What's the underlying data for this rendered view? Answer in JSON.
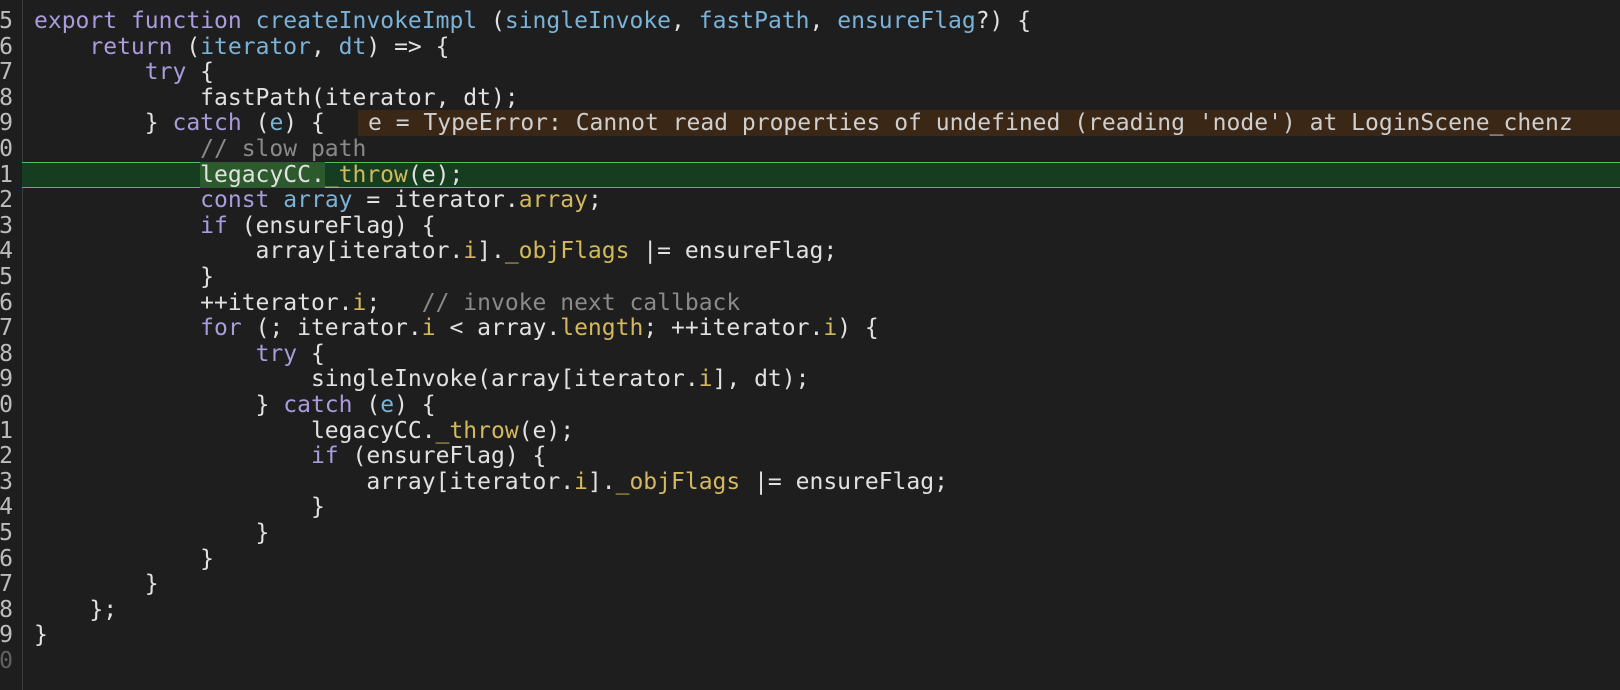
{
  "colors": {
    "background": "#1e1e1e",
    "keyword": "#a99bdc",
    "function": "#7ab2d8",
    "member": "#d3b95c",
    "comment": "#8a8a8a",
    "text": "#e1e1e1",
    "current_line": "#163d1f",
    "inline_value_bg": "#3a2716"
  },
  "gutter": {
    "line_numbers": [
      "5",
      "6",
      "7",
      "8",
      "9",
      "0",
      "1",
      "2",
      "3",
      "4",
      "5",
      "6",
      "7",
      "8",
      "9",
      "0",
      "1",
      "2",
      "3",
      "4",
      "5",
      "6",
      "7",
      "8",
      "9",
      "0"
    ]
  },
  "editor": {
    "current_line_index": 6,
    "inline_value": "e = TypeError: Cannot read properties of undefined (reading 'node') at LoginScene_chenz",
    "lines": [
      [
        [
          "k",
          "export"
        ],
        [
          "t",
          " "
        ],
        [
          "k",
          "function"
        ],
        [
          "t",
          " "
        ],
        [
          "f",
          "createInvokeImpl"
        ],
        [
          "t",
          " ("
        ],
        [
          "p",
          "singleInvoke"
        ],
        [
          "t",
          ", "
        ],
        [
          "p",
          "fastPath"
        ],
        [
          "t",
          ", "
        ],
        [
          "p",
          "ensureFlag"
        ],
        [
          "t",
          "?) {"
        ]
      ],
      [
        [
          "t",
          "    "
        ],
        [
          "k",
          "return"
        ],
        [
          "t",
          " ("
        ],
        [
          "p",
          "iterator"
        ],
        [
          "t",
          ", "
        ],
        [
          "p",
          "dt"
        ],
        [
          "t",
          ") => {"
        ]
      ],
      [
        [
          "t",
          "        "
        ],
        [
          "k",
          "try"
        ],
        [
          "t",
          " {"
        ]
      ],
      [
        [
          "t",
          "            fastPath(iterator, dt);"
        ]
      ],
      [
        [
          "t",
          "        } "
        ],
        [
          "k",
          "catch"
        ],
        [
          "t",
          " ("
        ],
        [
          "p",
          "e"
        ],
        [
          "t",
          ") {"
        ]
      ],
      [
        [
          "c",
          "            // slow path"
        ]
      ],
      [
        [
          "t",
          "            "
        ],
        [
          "x",
          "legacyCC."
        ],
        [
          "m",
          "_throw"
        ],
        [
          "t",
          "(e);"
        ]
      ],
      [
        [
          "t",
          "            "
        ],
        [
          "k",
          "const"
        ],
        [
          "t",
          " "
        ],
        [
          "p",
          "array"
        ],
        [
          "t",
          " = iterator."
        ],
        [
          "m",
          "array"
        ],
        [
          "t",
          ";"
        ]
      ],
      [
        [
          "t",
          "            "
        ],
        [
          "k",
          "if"
        ],
        [
          "t",
          " (ensureFlag) {"
        ]
      ],
      [
        [
          "t",
          "                array[iterator."
        ],
        [
          "m",
          "i"
        ],
        [
          "t",
          "]."
        ],
        [
          "m",
          "_objFlags"
        ],
        [
          "t",
          " |= ensureFlag;"
        ]
      ],
      [
        [
          "t",
          "            }"
        ]
      ],
      [
        [
          "t",
          "            ++iterator."
        ],
        [
          "m",
          "i"
        ],
        [
          "t",
          ";   "
        ],
        [
          "c",
          "// invoke next callback"
        ]
      ],
      [
        [
          "t",
          "            "
        ],
        [
          "k",
          "for"
        ],
        [
          "t",
          " (; iterator."
        ],
        [
          "m",
          "i"
        ],
        [
          "t",
          " < array."
        ],
        [
          "m",
          "length"
        ],
        [
          "t",
          "; ++iterator."
        ],
        [
          "m",
          "i"
        ],
        [
          "t",
          ") {"
        ]
      ],
      [
        [
          "t",
          "                "
        ],
        [
          "k",
          "try"
        ],
        [
          "t",
          " {"
        ]
      ],
      [
        [
          "t",
          "                    singleInvoke(array[iterator."
        ],
        [
          "m",
          "i"
        ],
        [
          "t",
          "], dt);"
        ]
      ],
      [
        [
          "t",
          "                } "
        ],
        [
          "k",
          "catch"
        ],
        [
          "t",
          " ("
        ],
        [
          "p",
          "e"
        ],
        [
          "t",
          ") {"
        ]
      ],
      [
        [
          "t",
          "                    legacyCC."
        ],
        [
          "m",
          "_throw"
        ],
        [
          "t",
          "(e);"
        ]
      ],
      [
        [
          "t",
          "                    "
        ],
        [
          "k",
          "if"
        ],
        [
          "t",
          " (ensureFlag) {"
        ]
      ],
      [
        [
          "t",
          "                        array[iterator."
        ],
        [
          "m",
          "i"
        ],
        [
          "t",
          "]."
        ],
        [
          "m",
          "_objFlags"
        ],
        [
          "t",
          " |= ensureFlag;"
        ]
      ],
      [
        [
          "t",
          "                    }"
        ]
      ],
      [
        [
          "t",
          "                }"
        ]
      ],
      [
        [
          "t",
          "            }"
        ]
      ],
      [
        [
          "t",
          "        }"
        ]
      ],
      [
        [
          "t",
          "    };"
        ]
      ],
      [
        [
          "t",
          "}"
        ]
      ],
      [
        [
          "t",
          ""
        ]
      ]
    ]
  }
}
